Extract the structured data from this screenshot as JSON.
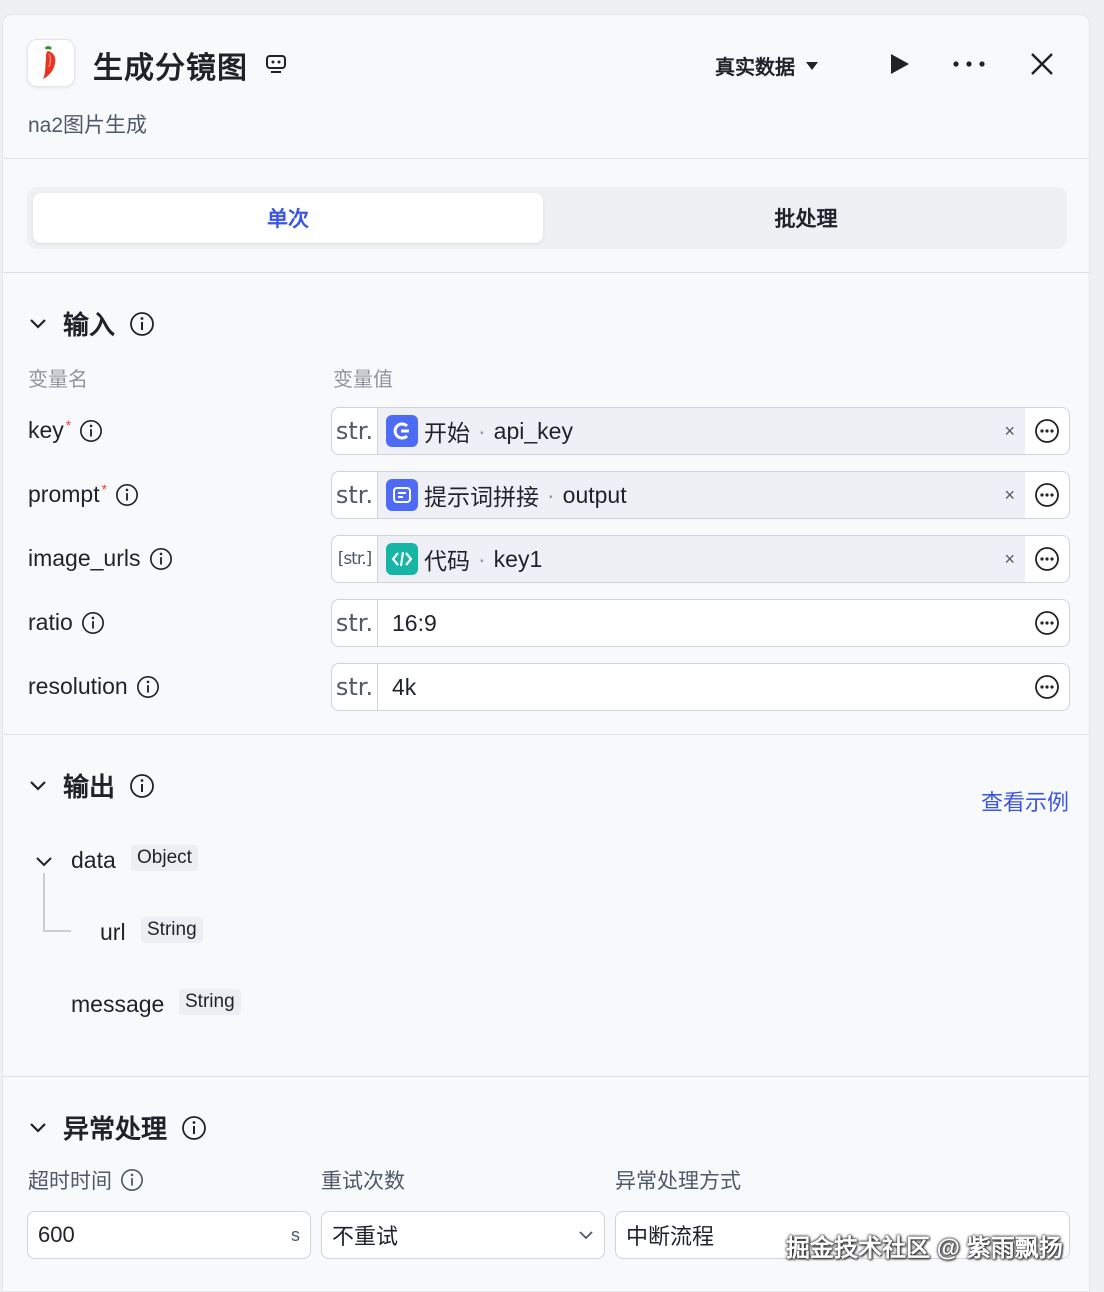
{
  "header": {
    "title": "生成分镜图",
    "subtitle": "na2图片生成",
    "data_mode": "真实数据"
  },
  "tabs": [
    {
      "label": "单次",
      "active": true
    },
    {
      "label": "批处理",
      "active": false
    }
  ],
  "input": {
    "title": "输入",
    "col_name": "变量名",
    "col_value": "变量值",
    "rows": [
      {
        "name": "key",
        "required": true,
        "type": "str.",
        "kind": "ref",
        "node": "开始",
        "var": "api_key"
      },
      {
        "name": "prompt",
        "required": true,
        "type": "str.",
        "kind": "ref",
        "node": "提示词拼接",
        "var": "output"
      },
      {
        "name": "image_urls",
        "required": false,
        "type": "[str.]",
        "kind": "ref",
        "node": "代码",
        "var": "key1"
      },
      {
        "name": "ratio",
        "required": false,
        "type": "str.",
        "kind": "literal",
        "value": "16:9"
      },
      {
        "name": "resolution",
        "required": false,
        "type": "str.",
        "kind": "literal",
        "value": "4k"
      }
    ],
    "required_mark": "*",
    "dot": "·",
    "clear_glyph": "×"
  },
  "output": {
    "title": "输出",
    "example_link": "查看示例",
    "fields": [
      {
        "name": "data",
        "type": "Object"
      },
      {
        "name": "url",
        "type": "String"
      },
      {
        "name": "message",
        "type": "String"
      }
    ]
  },
  "exception": {
    "title": "异常处理",
    "timeout_label": "超时时间",
    "timeout_value": "600",
    "timeout_unit": "s",
    "retry_label": "重试次数",
    "retry_value": "不重试",
    "mode_label": "异常处理方式",
    "mode_value": "中断流程"
  },
  "watermark": "掘金技术社区 @ 紫雨飘扬",
  "colors": {
    "accent": "#3b55e6",
    "start_node": "#4e6bf5",
    "code_node": "#17b5a6"
  }
}
